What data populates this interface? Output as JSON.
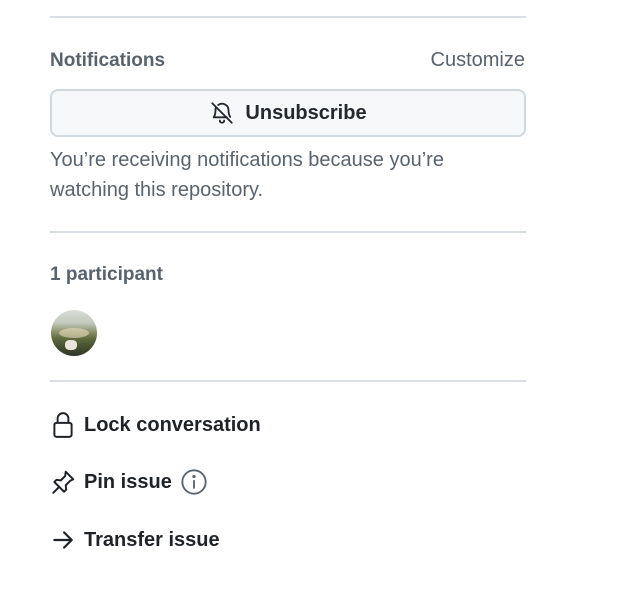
{
  "notifications": {
    "heading": "Notifications",
    "customize_label": "Customize",
    "unsubscribe_label": "Unsubscribe",
    "reason_text": "You’re receiving notifications because you’re watching this repository."
  },
  "participants": {
    "heading": "1 participant",
    "avatars": [
      {
        "name": "participant-avatar"
      }
    ]
  },
  "actions": {
    "lock_label": "Lock conversation",
    "pin_label": "Pin issue",
    "transfer_label": "Transfer issue"
  },
  "colors": {
    "muted_text": "#59636e",
    "primary_text": "#1f2328",
    "divider": "#d8dee4",
    "button_bg": "#f6f8fa",
    "button_border": "#d1d9e0"
  },
  "icons": {
    "unsubscribe": "bell-slash-icon",
    "lock": "lock-icon",
    "pin": "pin-icon",
    "info": "info-icon",
    "transfer": "arrow-right-icon"
  }
}
